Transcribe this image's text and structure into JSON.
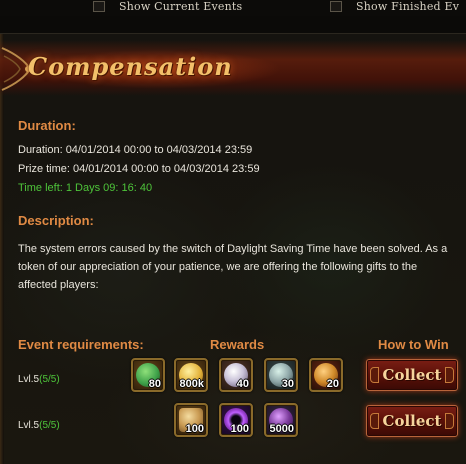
{
  "filters": {
    "current_label": "Show Current Events",
    "finished_label": "Show Finished Ev"
  },
  "event": {
    "title": "Compensation",
    "duration_heading": "Duration:",
    "duration_line": "Duration: 04/01/2014 00:00 to 04/03/2014 23:59",
    "prize_line": "Prize time: 04/01/2014 00:00 to 04/03/2014 23:59",
    "time_left_line": "Time left: 1  Days  09: 16: 40",
    "description_heading": "Description:",
    "description": "The system errors caused by the switch of Daylight Saving Time have been solved. As a token of our appreciation of your patience, we are offering the following gifts to the affected players:"
  },
  "columns": {
    "requirements": "Event requirements:",
    "rewards": "Rewards",
    "how_to_win": "How to Win"
  },
  "tiers": [
    {
      "requirement": "Lvl.5",
      "progress": "(5/5)",
      "collect_label": "Collect",
      "rewards": [
        {
          "icon": "green-gem-potion-icon",
          "qty": "80",
          "color": "#3fa24a"
        },
        {
          "icon": "gold-coins-icon",
          "qty": "800k",
          "color": "#e3b23a"
        },
        {
          "icon": "pearl-orb-icon",
          "qty": "40",
          "color": "#c9c2d8"
        },
        {
          "icon": "silver-potion-icon",
          "qty": "30",
          "color": "#8fa7a8"
        },
        {
          "icon": "golden-shield-icon",
          "qty": "20",
          "color": "#d08a2a"
        }
      ]
    },
    {
      "requirement": "Lvl.5",
      "progress": "(5/5)",
      "collect_label": "Collect",
      "rewards": [
        {
          "icon": "scroll-icon",
          "qty": "100",
          "color": "#c99a52"
        },
        {
          "icon": "purple-swirl-icon",
          "qty": "100",
          "color": "#9a3fd0"
        },
        {
          "icon": "purple-crystal-icon",
          "qty": "5000",
          "color": "#7a3a9a"
        }
      ]
    }
  ],
  "colors": {
    "heading": "#e08a44",
    "progress_green": "#4ec43a",
    "title_gold": "#f3c06a"
  }
}
